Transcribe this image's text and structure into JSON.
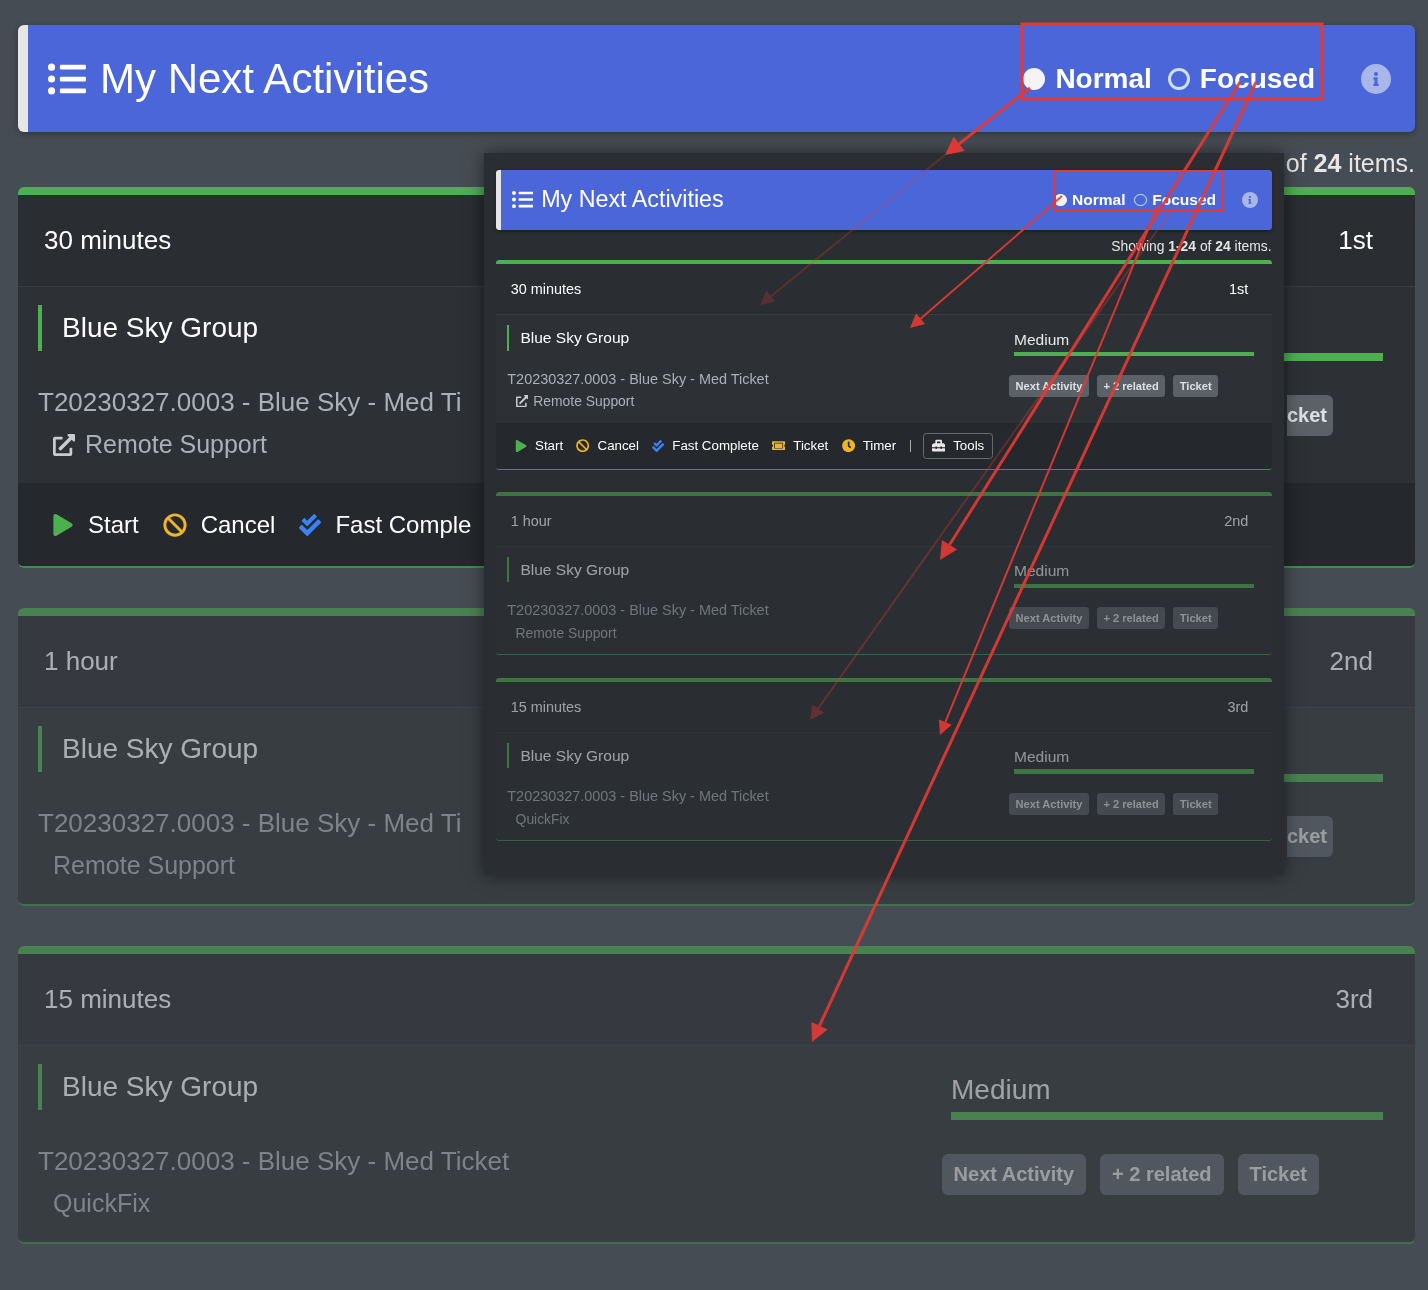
{
  "main": {
    "header": {
      "title": "My Next Activities",
      "modes": [
        {
          "label": "Normal",
          "selected": true
        },
        {
          "label": "Focused",
          "selected": false
        }
      ]
    },
    "showing": "of **24** items.",
    "cards": [
      {
        "duration": "30 minutes",
        "rank": "1st",
        "dimmed": false,
        "group": "Blue Sky Group",
        "ticket": "T20230327.0003 - Blue Sky - Med Ti",
        "sub": {
          "text": "Remote Support",
          "link": true
        },
        "tags": [
          "cket"
        ],
        "actions": [
          {
            "kind": "start",
            "label": "Start"
          },
          {
            "kind": "cancel",
            "label": "Cancel"
          },
          {
            "kind": "complete",
            "label": "Fast Comple"
          }
        ]
      },
      {
        "duration": "1 hour",
        "rank": "2nd",
        "dimmed": true,
        "group": "Blue Sky Group",
        "ticket": "T20230327.0003 - Blue Sky - Med Ti",
        "sub": {
          "text": "Remote Support",
          "link": false
        },
        "tags": [
          "cket"
        ]
      },
      {
        "duration": "15 minutes",
        "rank": "3rd",
        "dimmed": true,
        "group": "Blue Sky Group",
        "ticket": "T20230327.0003 - Blue Sky - Med Ticket",
        "sub": {
          "text": "QuickFix",
          "link": false
        },
        "priority": "Medium",
        "tags": [
          "Next Activity",
          "+ 2 related",
          "Ticket"
        ]
      }
    ]
  },
  "inset": {
    "header": {
      "title": "My Next Activities",
      "modes": [
        {
          "label": "Normal",
          "selected": true
        },
        {
          "label": "Focused",
          "selected": false
        }
      ]
    },
    "showing": "Showing **1-24** of **24** items.",
    "cards": [
      {
        "duration": "30 minutes",
        "rank": "1st",
        "dimmed": false,
        "group": "Blue Sky Group",
        "ticket": "T20230327.0003 - Blue Sky - Med Ticket",
        "sub": {
          "text": "Remote Support",
          "link": true
        },
        "priority": "Medium",
        "tags": [
          "Next Activity",
          "+ 2 related",
          "Ticket"
        ],
        "actions": [
          {
            "kind": "start",
            "label": "Start"
          },
          {
            "kind": "cancel",
            "label": "Cancel"
          },
          {
            "kind": "complete",
            "label": "Fast Complete"
          },
          {
            "kind": "ticket",
            "label": "Ticket"
          },
          {
            "kind": "timer",
            "label": "Timer"
          },
          {
            "kind": "tools",
            "label": "Tools"
          }
        ]
      },
      {
        "duration": "1 hour",
        "rank": "2nd",
        "dimmed": true,
        "group": "Blue Sky Group",
        "ticket": "T20230327.0003 - Blue Sky - Med Ticket",
        "sub": {
          "text": "Remote Support",
          "link": false
        },
        "priority": "Medium",
        "tags": [
          "Next Activity",
          "+ 2 related",
          "Ticket"
        ]
      },
      {
        "duration": "15 minutes",
        "rank": "3rd",
        "dimmed": true,
        "group": "Blue Sky Group",
        "ticket": "T20230327.0003 - Blue Sky - Med Ticket",
        "sub": {
          "text": "QuickFix",
          "link": false
        },
        "priority": "Medium",
        "tags": [
          "Next Activity",
          "+ 2 related",
          "Ticket"
        ]
      }
    ]
  }
}
